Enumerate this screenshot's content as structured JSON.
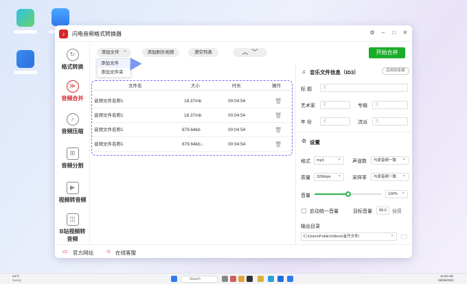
{
  "app": {
    "title": "闪电音频格式转换器",
    "icon": "lightning-music-icon"
  },
  "window_controls": [
    "settings-icon",
    "minimize-icon",
    "maximize-icon",
    "close-icon"
  ],
  "sidebar": {
    "items": [
      {
        "label": "格式转换",
        "icon": "refresh-icon",
        "active": false
      },
      {
        "label": "音频合并",
        "icon": "merge-icon",
        "active": true
      },
      {
        "label": "音频压缩",
        "icon": "compress-icon",
        "active": false
      },
      {
        "label": "音频分割",
        "icon": "split-icon",
        "active": false
      },
      {
        "label": "视频转音频",
        "icon": "video-icon",
        "active": false
      },
      {
        "label": "B站视频转音频",
        "icon": "bilibili-icon",
        "active": false
      }
    ]
  },
  "toolbar": {
    "add_file": "添加文件",
    "add_folder_video": "添加剧乐视频",
    "clear_list": "清空列表",
    "start": "开始合并"
  },
  "add_menu": {
    "items": [
      "添加文件",
      "添加文件夹"
    ]
  },
  "table": {
    "headers": [
      "文件名",
      "大小",
      "时长",
      "操作"
    ],
    "rows": [
      {
        "name": "音频文件名称1",
        "size": "18.37mb",
        "duration": "00:04:54"
      },
      {
        "name": "音频文件名称1",
        "size": "18.37mb",
        "duration": "00:04:54"
      },
      {
        "name": "音频文件名称1",
        "size": "879.64kb",
        "duration": "00:04:54"
      },
      {
        "name": "音频文件名称1",
        "size": "879.64kb...",
        "duration": "00:04:54"
      }
    ]
  },
  "info": {
    "title": "音乐文件信息（ID3）",
    "apply_all": "应用到全部",
    "fields": {
      "title": "标  题",
      "artist": "艺术家",
      "album": "专辑",
      "year": "年  份",
      "genre": "流派"
    },
    "placeholder": "无"
  },
  "settings": {
    "title": "设置",
    "format_label": "格式",
    "format_value": "mp3",
    "channel_label": "声道数",
    "channel_value": "与原音频一致",
    "quality_label": "质量",
    "quality_value": "320kbps",
    "samplerate_label": "采样率",
    "samplerate_value": "与原音频一致",
    "volume_label": "音量",
    "volume_value": "100%",
    "volume_level": 0.5,
    "normalize_label": "启动统一音量",
    "target_label": "目标音量",
    "target_value": "89.0",
    "target_unit": "分贝",
    "output_label": "输出目录",
    "output_path": "C:\\Users\\Public\\Videos\\金丹文件\\"
  },
  "footer": {
    "website": "官方网站",
    "support": "在线客服"
  },
  "taskbar": {
    "weather_temp": "24°C",
    "weather_desc": "Sunny",
    "search": "Search",
    "time": "11:00 AM",
    "date": "09/26/2023"
  },
  "colors": {
    "accent": "#d7262b",
    "start": "#1aad2a",
    "dashed": "#7b6ff0"
  }
}
